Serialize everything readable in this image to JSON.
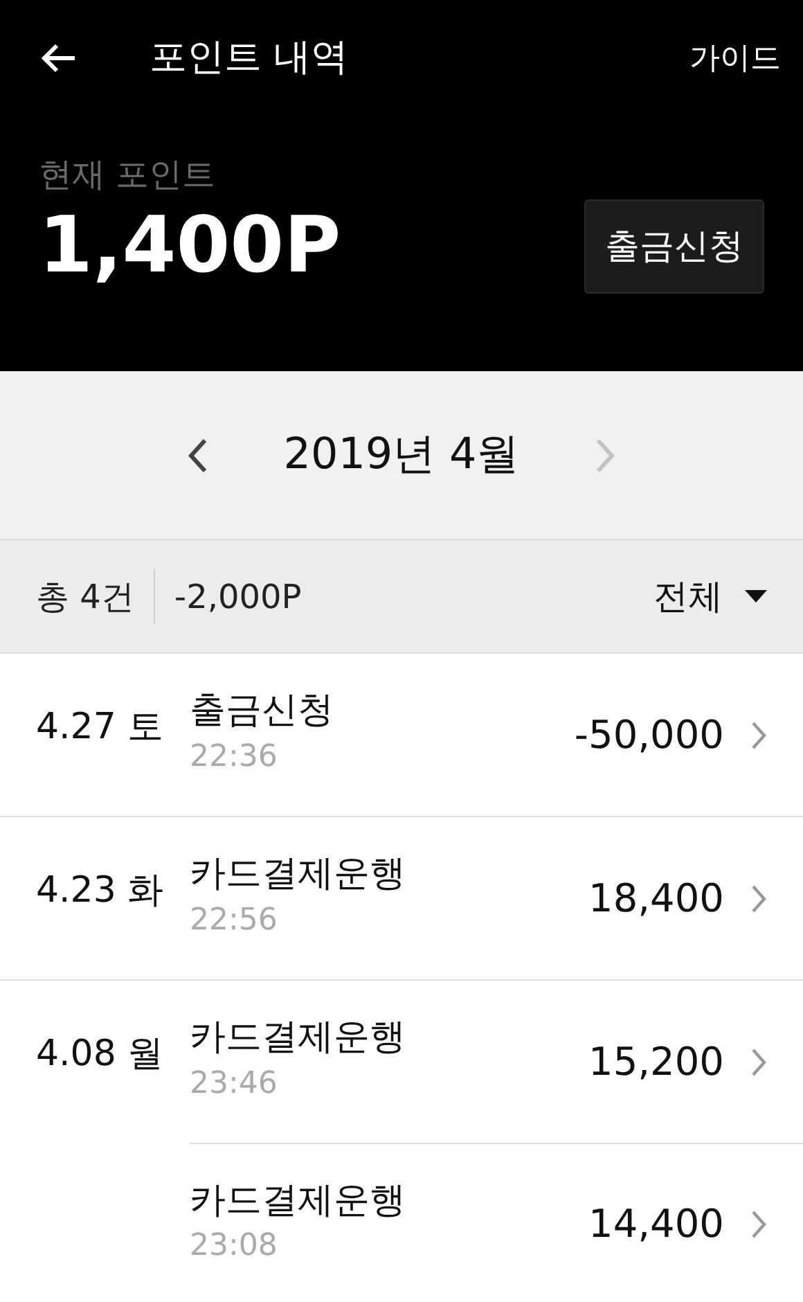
{
  "header": {
    "title": "포인트 내역",
    "guide": "가이드",
    "balance_label": "현재 포인트",
    "balance": "1,400P",
    "withdraw_button": "출금신청"
  },
  "month_nav": {
    "label": "2019년 4월",
    "prev_disabled": false,
    "next_disabled": true
  },
  "summary": {
    "count": "총 4건",
    "total": "-2,000P",
    "filter": "전체"
  },
  "days": [
    {
      "date": "4.27 토",
      "entries": [
        {
          "title": "출금신청",
          "time": "22:36",
          "amount": "-50,000"
        }
      ]
    },
    {
      "date": "4.23 화",
      "entries": [
        {
          "title": "카드결제운행",
          "time": "22:56",
          "amount": "18,400"
        }
      ]
    },
    {
      "date": "4.08 월",
      "entries": [
        {
          "title": "카드결제운행",
          "time": "23:46",
          "amount": "15,200"
        },
        {
          "title": "카드결제운행",
          "time": "23:08",
          "amount": "14,400"
        }
      ]
    }
  ]
}
